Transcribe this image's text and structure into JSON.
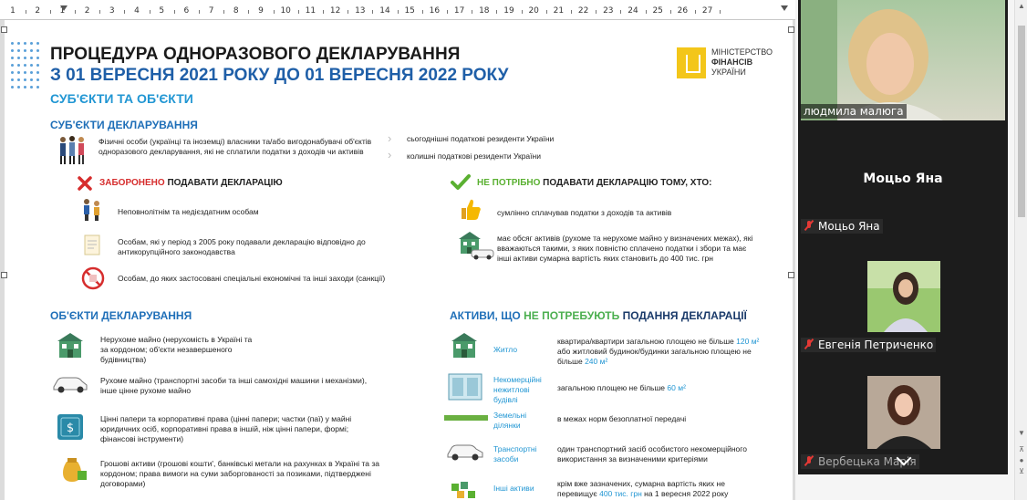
{
  "ruler": {
    "numbers": [
      "1",
      "2",
      "1",
      "2",
      "3",
      "4",
      "5",
      "6",
      "7",
      "8",
      "9",
      "10",
      "11",
      "12",
      "13",
      "14",
      "15",
      "16",
      "17",
      "18",
      "19",
      "20",
      "21",
      "22",
      "23",
      "24",
      "25",
      "26",
      "27"
    ]
  },
  "document": {
    "title_line1": "ПРОЦЕДУРА ОДНОРАЗОВОГО ДЕКЛАРУВАННЯ",
    "title_line2": "З 01 ВЕРЕСНЯ 2021 РОКУ ДО 01 ВЕРЕСНЯ 2022 РОКУ",
    "subtitle": "СУБ'ЄКТИ ТА ОБ'ЄКТИ",
    "logo": {
      "line1": "МІНІСТЕРСТВО",
      "line2": "ФІНАНСІВ",
      "line3": "УКРАЇНИ",
      "color": "#f3c61a"
    },
    "subjects": {
      "heading": "СУБ'ЄКТИ ДЕКЛАРУВАННЯ",
      "description": "Фізичні особи (українці та іноземці) власники та/або вигодонабувачі об'єктів одноразового декларування, які не сплатили податки з доходів чи активів",
      "residents_now": "сьогоднішні податкові резиденти України",
      "residents_former": "колишні податкові резиденти України"
    },
    "forbidden": {
      "heading_red": "ЗАБОРОНЕНО",
      "heading_rest": " ПОДАВАТИ ДЕКЛАРАЦІЮ",
      "items": [
        "Неповнолітнім та недієздатним особам",
        "Особам, які у період з 2005 року подавали декларацію відповідно до антикорупційного законодавства",
        "Особам, до яких застосовані спеціальні економічні та інші заходи (санкції)"
      ]
    },
    "not_required": {
      "heading_green": "НЕ ПОТРІБНО",
      "heading_rest": " ПОДАВАТИ ДЕКЛАРАЦІЮ ТОМУ, ХТО:",
      "items": [
        "сумлінно сплачував податки з доходів та активів",
        "має обсяг активів (рухоме та нерухоме майно у визначених межах), які вважаються такими, з яких повністю сплачено податки і збори та має інші активи сумарна вартість яких становить до 400 тис. грн"
      ]
    },
    "objects": {
      "heading": "ОБ'ЄКТИ ДЕКЛАРУВАННЯ",
      "items": [
        "Нерухоме майно (нерухомість в Україні та за кордоном; об'єкти незавершеного будівництва)",
        "Рухоме майно (транспортні засоби та інші самохідні машини і механізми), інше цінне рухоме майно",
        "Цінні папери та корпоративні права (цінні папери; частки (паї) у майні юридичних осіб, корпоративні права в іншій, ніж цінні папери, формі; фінансові інструменти)",
        "Грошові активи (грошові кошти', банківські метали на рахунках в Україні та за кордоном; права вимоги на суми заборгованості за позиками, підтверджені договорами)"
      ]
    },
    "assets": {
      "heading_a": "АКТИВИ, ЩО ",
      "heading_green": "НЕ ПОТРЕБУЮТЬ",
      "heading_b": " ПОДАННЯ ДЕКЛАРАЦІЇ",
      "rows": [
        {
          "label": "Житло",
          "text_a": "квартира/квартири загальною площею не більше ",
          "hl1": "120 м²",
          "text_b": " або житловий будинок/будинки загальною площею не більше ",
          "hl2": "240 м²"
        },
        {
          "label": "Некомерційні нежитлові будівлі",
          "text_a": "загальною площею не більше ",
          "hl1": "60 м²",
          "text_b": "",
          "hl2": ""
        },
        {
          "label": "Земельні ділянки",
          "text_a": "в межах норм безоплатної передачі",
          "hl1": "",
          "text_b": "",
          "hl2": ""
        },
        {
          "label": "Транспортні засоби",
          "text_a": "один транспортний засіб особистого некомерційного використання за визначеними критеріями",
          "hl1": "",
          "text_b": "",
          "hl2": ""
        },
        {
          "label": "Інші активи",
          "text_a": "крім вже зазначених, сумарна вартість яких не перевищує ",
          "hl1": "400 тис. грн",
          "text_b": " на 1 вересня 2022 року",
          "hl2": ""
        }
      ]
    }
  },
  "participants": {
    "p1_name": "людмила малюга",
    "p2_big": "Моцьо Яна",
    "p2_name": "Моцьо Яна",
    "p3_name": "Евгенія Петриченко",
    "p4_name": "Вербецька Марія"
  }
}
